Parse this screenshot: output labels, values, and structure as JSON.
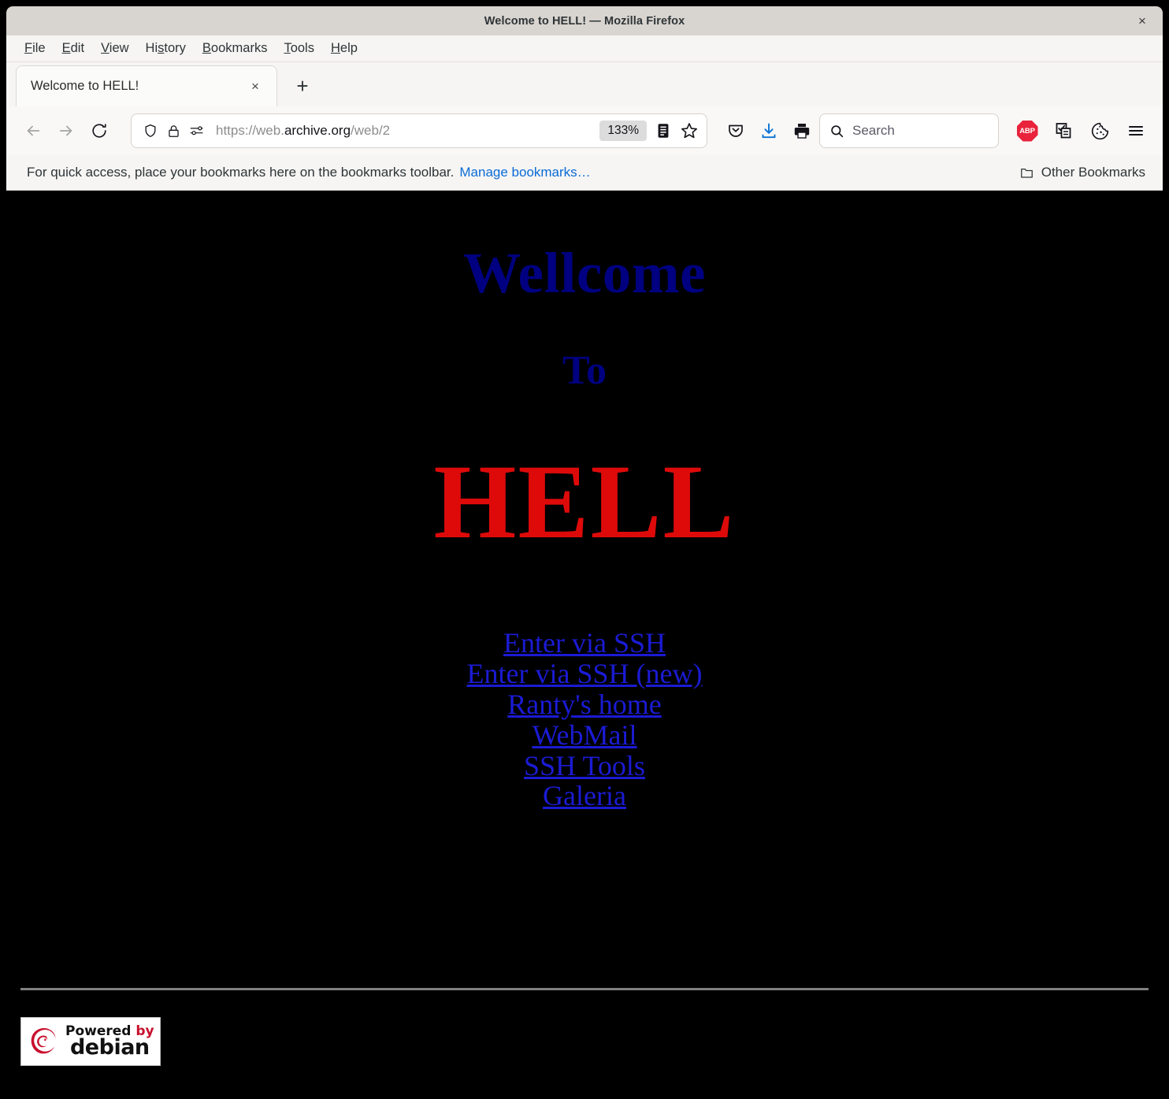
{
  "window": {
    "title": "Welcome to HELL! — Mozilla Firefox",
    "close_label": "×"
  },
  "menubar": {
    "items": [
      {
        "name": "file",
        "pre": "",
        "accel": "F",
        "post": "ile"
      },
      {
        "name": "edit",
        "pre": "",
        "accel": "E",
        "post": "dit"
      },
      {
        "name": "view",
        "pre": "",
        "accel": "V",
        "post": "iew"
      },
      {
        "name": "history",
        "pre": "Hi",
        "accel": "s",
        "post": "tory"
      },
      {
        "name": "bookmarks",
        "pre": "",
        "accel": "B",
        "post": "ookmarks"
      },
      {
        "name": "tools",
        "pre": "",
        "accel": "T",
        "post": "ools"
      },
      {
        "name": "help",
        "pre": "",
        "accel": "H",
        "post": "elp"
      }
    ]
  },
  "tabs": {
    "active": {
      "title": "Welcome to HELL!",
      "close_label": "×"
    },
    "new_tab_label": "+"
  },
  "toolbar": {
    "back_icon": "back-arrow-icon",
    "forward_icon": "forward-arrow-icon",
    "reload_icon": "reload-icon",
    "shield_icon": "shield-icon",
    "lock_icon": "padlock-icon",
    "permissions_icon": "permissions-icon",
    "url_prefix": "https://web.",
    "url_domain": "archive.org",
    "url_suffix": "/web/2",
    "zoom_level": "133%",
    "reader_icon": "reader-mode-icon",
    "bookmark_star_icon": "star-icon",
    "pocket_icon": "pocket-icon",
    "download_icon": "download-icon",
    "print_icon": "print-icon",
    "adblock_label": "ABP",
    "adblock_icon": "adblock-plus-icon",
    "clipboard_icon": "clipboard-copy-icon",
    "cookie_icon": "cookie-icon",
    "menu_icon": "hamburger-menu-icon"
  },
  "search": {
    "icon": "search-icon",
    "placeholder": "Search",
    "value": ""
  },
  "bookmarks_bar": {
    "hint": "For quick access, place your bookmarks here on the bookmarks toolbar.",
    "manage_link": "Manage bookmarks…",
    "other_bookmarks": "Other Bookmarks",
    "folder_icon": "folder-icon"
  },
  "page": {
    "heading_1": "Wellcome",
    "heading_2": "To",
    "heading_3": "HELL",
    "links": [
      "Enter via SSH",
      "Enter via SSH (new)",
      "Ranty's home",
      "WebMail",
      "SSH Tools",
      "Galeria"
    ],
    "footer": {
      "badge_top_word": "Powered",
      "badge_top_accent": "by",
      "badge_bottom": "debian",
      "badge_icon": "debian-swirl-logo"
    },
    "colors": {
      "background": "#000000",
      "heading_blue": "#000080",
      "heading_red": "#de0a0a",
      "link_blue": "#1b1bd4",
      "rule_gray": "#808080"
    }
  }
}
